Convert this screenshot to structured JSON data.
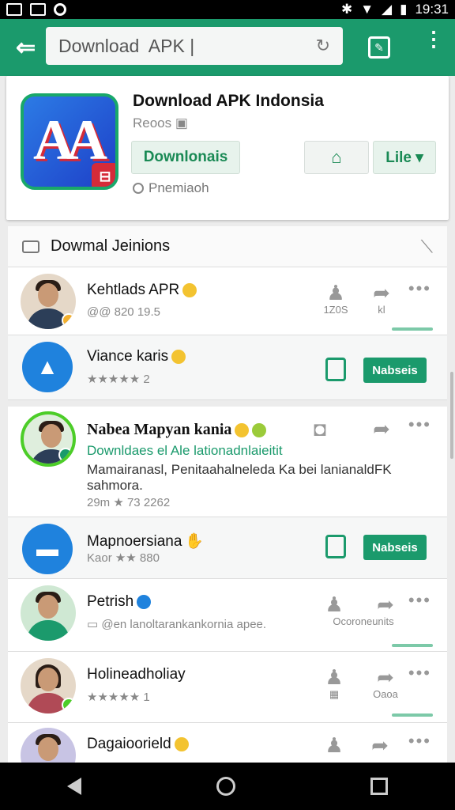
{
  "status": {
    "time": "19:31"
  },
  "appbar": {
    "search_value": "Download  APK |"
  },
  "app": {
    "title": "Download APK Indonsia",
    "subtitle": "Reoos",
    "download_label": "Downlonais",
    "like_label": "Lile ▾",
    "note": "Pnemiaoh"
  },
  "section": {
    "title": "Dowmal Jeinions"
  },
  "rows": [
    {
      "name": "Kehtlads APR",
      "meta": "@@  820 19.5",
      "act1": "1Z0S",
      "act2": "kl"
    },
    {
      "name": "Viance karis",
      "meta": "★★★★★ 2",
      "button": "Nabseis"
    },
    {
      "name": "Nabea Mapyan kania",
      "line1": "Downldaes el Ale lationadnlaieitit",
      "line2": "Mamairanasl, Penitaahalneleda Ka bei lanianaldFK sahmora.",
      "meta": "29m ★ 73 2262"
    },
    {
      "name": "Mapnoersiana",
      "meta": "Kaor ★★ 880",
      "button": "Nabseis"
    },
    {
      "name": "Petrish",
      "meta": "@en lanoltarankankornia apee.",
      "act2": "Ocoroneunits"
    },
    {
      "name": "Holineadholiay",
      "meta": "★★★★★ 1",
      "act2": "Oaoa"
    },
    {
      "name": "Dagaioorield",
      "meta": ""
    }
  ]
}
